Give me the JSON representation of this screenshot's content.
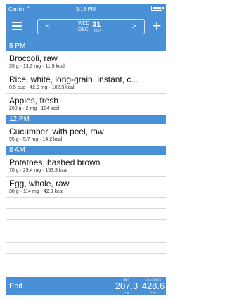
{
  "status_bar": {
    "carrier": "Carrier",
    "time": "5:18 PM"
  },
  "nav": {
    "prev_label": "<",
    "next_label": ">",
    "date": {
      "weekday": "WED",
      "day": "31",
      "month": "DEC",
      "year": "2014"
    }
  },
  "sections": [
    {
      "header": "5 PM",
      "items": [
        {
          "name": "Broccoli, raw",
          "detail": "35 g · 13.3 mg · 11.9 kcal"
        },
        {
          "name": "Rice, white, long-grain, instant, c...",
          "detail": "0.5 cup · 42.9 mg · 102.3 kcal"
        },
        {
          "name": "Apples, fresh",
          "detail": "200 g · 2 mg · 104 kcal"
        }
      ]
    },
    {
      "header": "12 PM",
      "items": [
        {
          "name": "Cucumber, with peel, raw",
          "detail": "95 g · 5.7 mg · 14.2 kcal"
        }
      ]
    },
    {
      "header": "8 AM",
      "items": [
        {
          "name": "Potatoes, hashed brown",
          "detail": "70 g · 29.4 mg · 153.3 kcal"
        },
        {
          "name": "Egg, whole, raw",
          "detail": "30 g · 114 mg · 42.9 kcal"
        }
      ]
    }
  ],
  "bottom_bar": {
    "edit_label": "Edit",
    "met": {
      "label": "MET",
      "value": "207.3",
      "unit": "mg"
    },
    "calories": {
      "label": "CALORIES",
      "value": "428.6",
      "unit": "kcal"
    }
  },
  "colors": {
    "accent": "#4a90d6",
    "separator": "#d9d9d9"
  }
}
